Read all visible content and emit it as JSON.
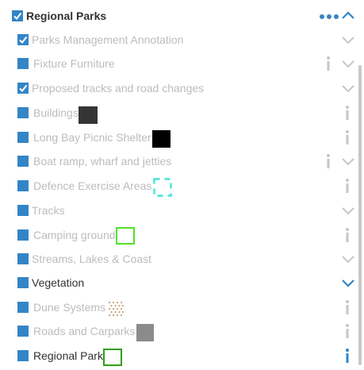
{
  "layers": {
    "header": {
      "label": "Regional Parks",
      "checked": true
    },
    "items": [
      {
        "label": "Parks Management Annotation",
        "checked": true
      },
      {
        "label": "Fixture Furniture",
        "checked": false
      },
      {
        "label": "Proposed tracks and road changes",
        "checked": true
      },
      {
        "label": "Buildings",
        "checked": false
      },
      {
        "label": "Long Bay Picnic Shelter",
        "checked": false
      },
      {
        "label": "Boat ramp, wharf and jetties",
        "checked": false
      },
      {
        "label": "Defence Exercise Areas",
        "checked": false
      },
      {
        "label": "Tracks",
        "checked": false
      },
      {
        "label": "Camping ground",
        "checked": false
      },
      {
        "label": "Streams, Lakes & Coast",
        "checked": false
      },
      {
        "label": "Vegetation",
        "checked": false
      },
      {
        "label": "Dune Systems",
        "checked": false
      },
      {
        "label": "Roads and Carparks",
        "checked": false
      },
      {
        "label": "Regional Park",
        "checked": false
      }
    ]
  },
  "icons": {
    "more": "more-dots-icon",
    "collapse": "chevron-up-icon",
    "expand": "chevron-down-icon",
    "info": "info-icon",
    "check": "check-icon"
  },
  "colors": {
    "accent": "#3385c6",
    "muted_text": "#bcbcbc",
    "dark_text": "#323232",
    "muted_icon": "#c6c6c6",
    "symbol_dark": "#353535",
    "symbol_black": "#000000",
    "symbol_cyan": "#46e3d9",
    "symbol_lime": "#54e02c",
    "symbol_dotted": "#c9a27c",
    "symbol_grey": "#8b8b8b",
    "symbol_green": "#2ea114"
  }
}
